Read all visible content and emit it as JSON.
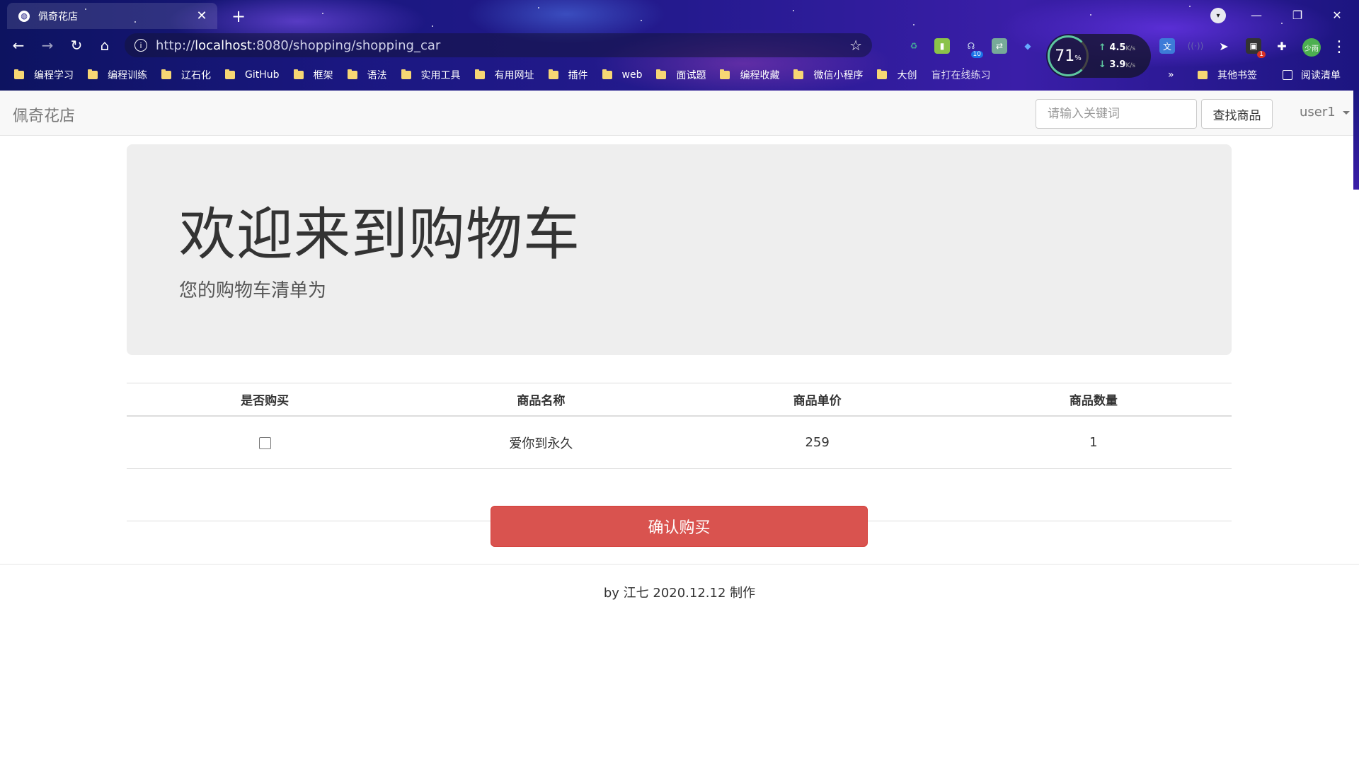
{
  "browser": {
    "tab_title": "佩奇花店",
    "url_host": "localhost",
    "url_prefix": "http://",
    "url_rest": ":8080/shopping/shopping_car",
    "speed_percent": "71",
    "speed_percent_unit": "%",
    "upload": "4.5",
    "download": "3.9",
    "speed_unit": "K/s",
    "ext_badge_1": "10",
    "ext_badge_2": "1",
    "avatar_text": "少雨",
    "bookmarks": [
      "编程学习",
      "编程训练",
      "辽石化",
      "GitHub",
      "框架",
      "语法",
      "实用工具",
      "有用网址",
      "插件",
      "web",
      "面试题",
      "编程收藏",
      "微信小程序",
      "大创",
      "盲打在线练习"
    ],
    "bookmark_more": "»",
    "other_bookmarks": "其他书签",
    "reading_list": "阅读清单"
  },
  "navbar": {
    "brand": "佩奇花店",
    "search_placeholder": "请输入关键词",
    "search_button": "查找商品",
    "user": "user1"
  },
  "jumbotron": {
    "title": "欢迎来到购物车",
    "subtitle": "您的购物车清单为"
  },
  "cart": {
    "headers": [
      "是否购买",
      "商品名称",
      "商品单价",
      "商品数量"
    ],
    "rows": [
      {
        "name": "爱你到永久",
        "price": "259",
        "qty": "1"
      }
    ]
  },
  "confirm_button": "确认购买",
  "footer": "by 江七 2020.12.12 制作"
}
